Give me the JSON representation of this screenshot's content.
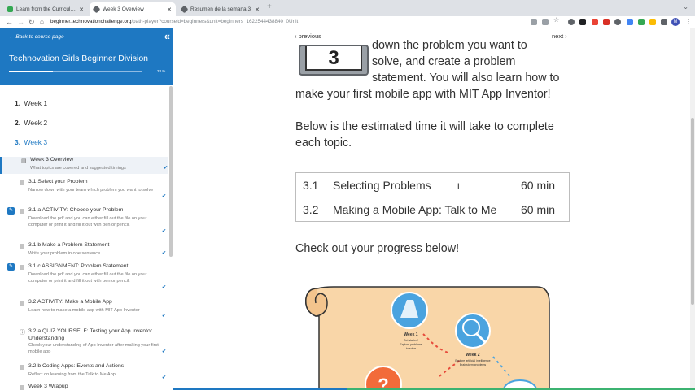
{
  "browser": {
    "tabs": [
      {
        "title": "Learn from the Curriculum - Te",
        "favicon_color": "#34a853"
      },
      {
        "title": "Week 3 Overview",
        "favicon_color": "#5f6368"
      },
      {
        "title": "Resumen de la semana 3",
        "favicon_color": "#5f6368"
      }
    ],
    "active_tab_index": 1,
    "new_tab_label": "+",
    "url_host": "beginner.technovationchallenge.org",
    "url_path": "/path-player?courseid=beginners&unit=beginners_1622544438840_0Unit",
    "profile_initial": "M"
  },
  "sidebar": {
    "back_label": "Back to course page",
    "collapse_glyph": "«",
    "course_title": "Technovation Girls Beginner Division",
    "progress_percent": 33,
    "progress_label": "33 %",
    "weeks": [
      {
        "number": "1.",
        "label": "Week 1"
      },
      {
        "number": "2.",
        "label": "Week 2"
      },
      {
        "number": "3.",
        "label": "Week 3"
      }
    ],
    "items": [
      {
        "title": "Week 3 Overview",
        "desc": "What topics are covered and suggested timings",
        "check": "✔",
        "flag": ""
      },
      {
        "title": "3.1 Select your Problem",
        "desc": "Narrow down with your team which problem you want to solve",
        "check": "✔",
        "flag": ""
      },
      {
        "title": "3.1.a ACTIVITY: Choose your Problem",
        "desc": "Download the pdf and you can either fill out the file on your computer or print it and fill it out with pen or pencil.",
        "check": "✔",
        "flag": "✎"
      },
      {
        "title": "3.1.b Make a Problem Statement",
        "desc": "Write your problem in one sentence",
        "check": "✔",
        "flag": ""
      },
      {
        "title": "3.1.c ASSIGNMENT: Problem Statement",
        "desc": "Download the pdf and you can either fill out the file on your computer or print it and fill it out with pen or pencil.",
        "check": "✔",
        "flag": "✎"
      },
      {
        "title": "3.2 ACTIVITY: Make a Mobile App",
        "desc": "Learn how to make a mobile app with MIT App Inventor",
        "check": "✔",
        "flag": ""
      },
      {
        "title": "3.2.a QUIZ YOURSELF: Testing your App Inventor Understanding",
        "desc": "Check your understanding of App Inventor after making your first mobile app",
        "check": "✔",
        "flag": ""
      },
      {
        "title": "3.2.b Coding Apps: Events and Actions",
        "desc": "Reflect on learning from the Talk to Me App",
        "check": "✔",
        "flag": ""
      },
      {
        "title": "Week 3 Wrapup",
        "desc": "",
        "check": "",
        "flag": ""
      }
    ]
  },
  "main": {
    "prev_label": "‹ previous",
    "next_label": "next ›",
    "badge_number": "3",
    "intro_lines": [
      "down the problem you want to",
      "solve, and create a problem",
      "statement. You will also learn how to",
      "make your first mobile app with MIT App Inventor!"
    ],
    "estimate_lines": [
      "Below is the estimated time it will take to complete",
      "each topic."
    ],
    "topics": [
      {
        "num": "3.1",
        "name": "Selecting Problems",
        "time": "60 min"
      },
      {
        "num": "3.2",
        "name": "Making a Mobile App: Talk to Me",
        "time": "60 min"
      }
    ],
    "progress_heading": "Check out your progress below!",
    "map": {
      "week1_title": "Week 1",
      "week1_line1": "Get started!",
      "week1_line2": "Explore problems",
      "week1_line3": "to solve",
      "week2_title": "Week 2",
      "week2_line1": "Explore artificial intelligence",
      "week2_line2": "Brainstorm problems"
    }
  },
  "colors": {
    "brand_blue": "#1e78c2",
    "parchment": "#f9d6a8",
    "progress_green": "#3cb371"
  }
}
